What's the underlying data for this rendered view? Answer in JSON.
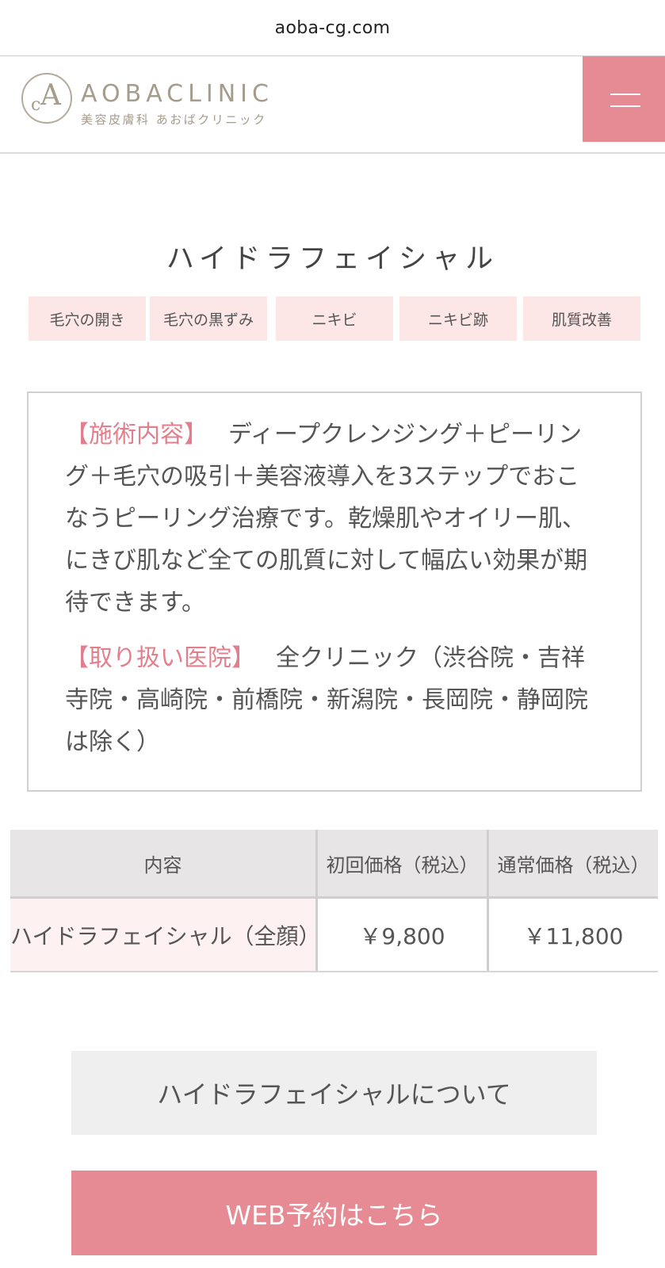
{
  "browser": {
    "url": "aoba-cg.com"
  },
  "header": {
    "logo_mark_c": "c",
    "logo_mark_a": "A",
    "logo_text": "AOBACLINIC",
    "logo_sub": "美容皮膚科 あおばクリニック",
    "menu_icon": "hamburger-icon",
    "accent_color": "#e68a94"
  },
  "main": {
    "title": "ハイドラフェイシャル",
    "tags": [
      "毛穴の開き",
      "毛穴の黒ずみ",
      "ニキビ",
      "ニキビ跡",
      "肌質改善"
    ],
    "info": {
      "content_label": "【施術内容】",
      "content_text": "ディープクレンジング＋ピーリング＋毛穴の吸引＋美容液導入を3ステップでおこなうピーリング治療です。乾燥肌やオイリー肌、にきび肌など全ての肌質に対して幅広い効果が期待できます。",
      "clinics_label": "【取り扱い医院】",
      "clinics_text": "全クリニック（渋谷院・吉祥寺院・高崎院・前橋院・新潟院・長岡院・静岡院は除く）"
    },
    "price_table": {
      "headers": [
        "内容",
        "初回価格（税込）",
        "通常価格（税込）"
      ],
      "rows": [
        [
          "ハイドラフェイシャル（全顔）",
          "￥9,800",
          "￥11,800"
        ]
      ]
    },
    "about_button": "ハイドラフェイシャルについて",
    "reserve_button": "WEB予約はこちら"
  }
}
